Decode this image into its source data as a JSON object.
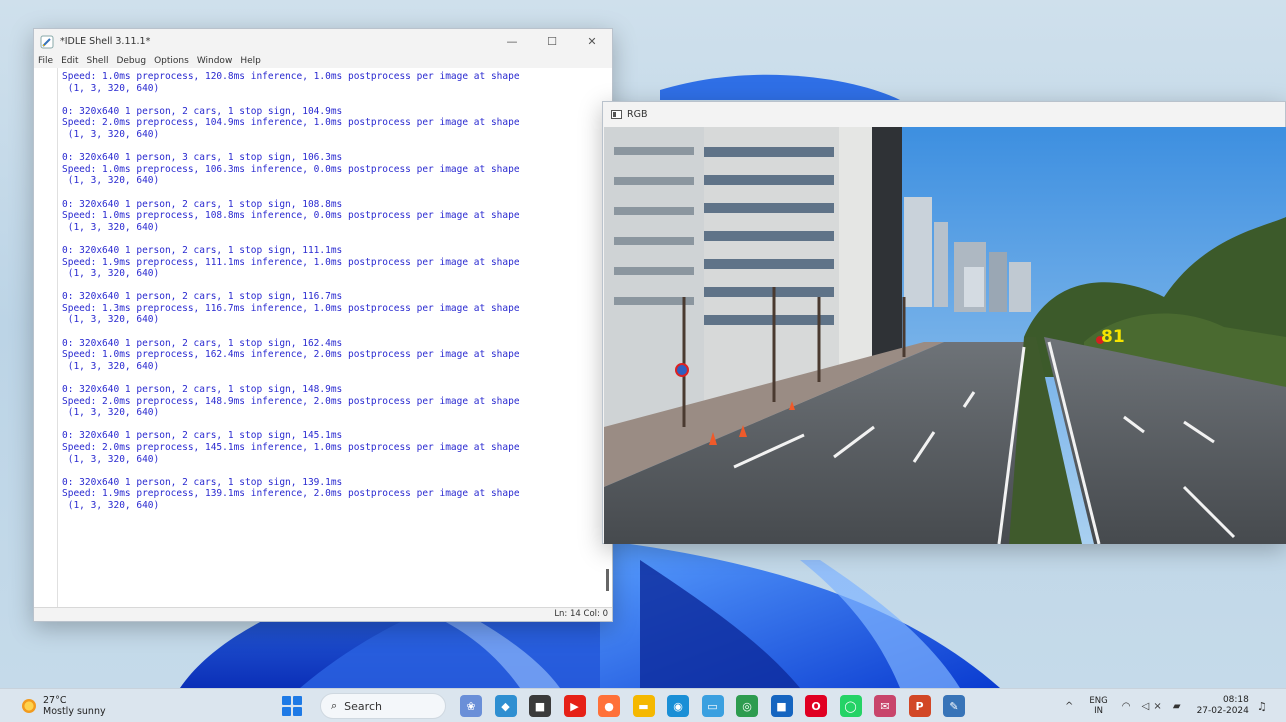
{
  "idle": {
    "title": "*IDLE Shell 3.11.1*",
    "controls": {
      "minimize": "—",
      "maximize": "☐",
      "close": "✕"
    },
    "menu": [
      "File",
      "Edit",
      "Shell",
      "Debug",
      "Options",
      "Window",
      "Help"
    ],
    "first_lines": [
      "Speed: 1.0ms preprocess, 120.8ms inference, 1.0ms postprocess per image at shape",
      " (1, 3, 320, 640)"
    ],
    "blocks": [
      [
        "0: 320x640 1 person, 2 cars, 1 stop sign, 104.9ms",
        "Speed: 2.0ms preprocess, 104.9ms inference, 1.0ms postprocess per image at shape",
        " (1, 3, 320, 640)"
      ],
      [
        "0: 320x640 1 person, 3 cars, 1 stop sign, 106.3ms",
        "Speed: 1.0ms preprocess, 106.3ms inference, 0.0ms postprocess per image at shape",
        " (1, 3, 320, 640)"
      ],
      [
        "0: 320x640 1 person, 2 cars, 1 stop sign, 108.8ms",
        "Speed: 1.0ms preprocess, 108.8ms inference, 0.0ms postprocess per image at shape",
        " (1, 3, 320, 640)"
      ],
      [
        "0: 320x640 1 person, 2 cars, 1 stop sign, 111.1ms",
        "Speed: 1.9ms preprocess, 111.1ms inference, 1.0ms postprocess per image at shape",
        " (1, 3, 320, 640)"
      ],
      [
        "0: 320x640 1 person, 2 cars, 1 stop sign, 116.7ms",
        "Speed: 1.3ms preprocess, 116.7ms inference, 1.0ms postprocess per image at shape",
        " (1, 3, 320, 640)"
      ],
      [
        "0: 320x640 1 person, 2 cars, 1 stop sign, 162.4ms",
        "Speed: 1.0ms preprocess, 162.4ms inference, 2.0ms postprocess per image at shape",
        " (1, 3, 320, 640)"
      ],
      [
        "0: 320x640 1 person, 2 cars, 1 stop sign, 148.9ms",
        "Speed: 2.0ms preprocess, 148.9ms inference, 2.0ms postprocess per image at shape",
        " (1, 3, 320, 640)"
      ],
      [
        "0: 320x640 1 person, 2 cars, 1 stop sign, 145.1ms",
        "Speed: 2.0ms preprocess, 145.1ms inference, 1.0ms postprocess per image at shape",
        " (1, 3, 320, 640)"
      ],
      [
        "0: 320x640 1 person, 2 cars, 1 stop sign, 139.1ms",
        "Speed: 1.9ms preprocess, 139.1ms inference, 2.0ms postprocess per image at shape",
        " (1, 3, 320, 640)"
      ]
    ],
    "status": "Ln: 14  Col: 0",
    "text_color": "#2a2ad0"
  },
  "rgb": {
    "title": "RGB",
    "detection_label": "81",
    "label_color": "#f5e400"
  },
  "taskbar": {
    "weather_temp": "27°C",
    "weather_desc": "Mostly sunny",
    "search_label": "Search",
    "apps": [
      {
        "name": "copilot-app-icon",
        "glyph": "❀",
        "color": "#6a8fd8"
      },
      {
        "name": "paint-app-icon",
        "glyph": "◆",
        "color": "#2f8fd1"
      },
      {
        "name": "files-app-icon",
        "glyph": "■",
        "color": "#3b3b3b"
      },
      {
        "name": "youtube-app-icon",
        "glyph": "▶",
        "color": "#e62117"
      },
      {
        "name": "firefox-app-icon",
        "glyph": "●",
        "color": "#ff7139"
      },
      {
        "name": "file-explorer-app-icon",
        "glyph": "▬",
        "color": "#f5b800"
      },
      {
        "name": "edge-app-icon",
        "glyph": "◉",
        "color": "#1a8fd6"
      },
      {
        "name": "mobile-app-icon",
        "glyph": "▭",
        "color": "#3aa0e0"
      },
      {
        "name": "chrome-app-icon",
        "glyph": "◎",
        "color": "#2d9c4f"
      },
      {
        "name": "store-app-icon",
        "glyph": "■",
        "color": "#1565c0"
      },
      {
        "name": "opera-app-icon",
        "glyph": "O",
        "color": "#e00022"
      },
      {
        "name": "whatsapp-app-icon",
        "glyph": "◯",
        "color": "#25d366"
      },
      {
        "name": "mail-app-icon",
        "glyph": "✉",
        "color": "#c8456b"
      },
      {
        "name": "powerpoint-app-icon",
        "glyph": "P",
        "color": "#d24726"
      },
      {
        "name": "idle-app-icon",
        "glyph": "✎",
        "color": "#3874b8"
      }
    ],
    "lang_top": "ENG",
    "lang_bottom": "IN",
    "time": "08:18",
    "date": "27-02-2024"
  }
}
